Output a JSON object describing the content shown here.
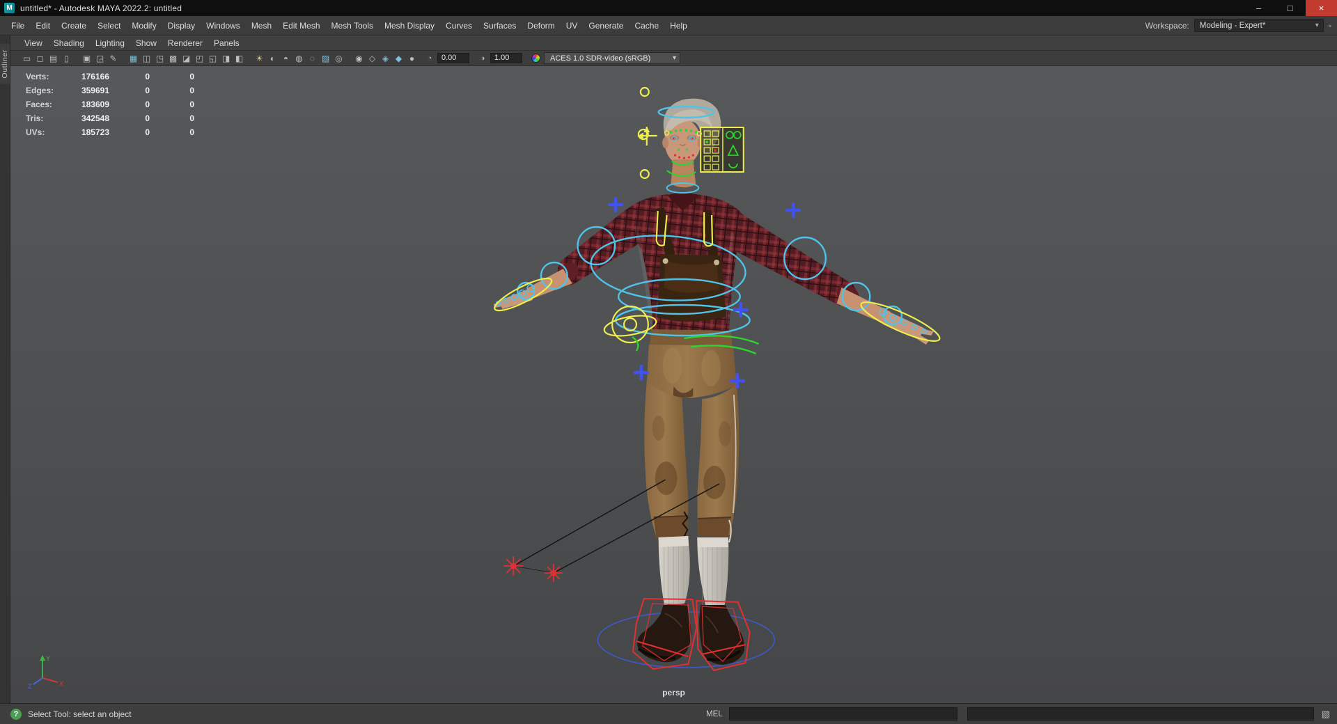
{
  "colors": {
    "rig-cyan": "#4fc3e8",
    "rig-yellow": "#eded4e",
    "rig-green": "#2ed32e",
    "rig-red": "#e23030",
    "rig-blue": "#4053f2",
    "ground-blue": "#3d5bc0"
  },
  "title_bar": {
    "app_icon": "M",
    "title": "untitled* - Autodesk MAYA 2022.2: untitled",
    "minimize_glyph": "–",
    "maximize_glyph": "□",
    "close_glyph": "×"
  },
  "menubar": {
    "items": [
      {
        "name": "menu-item-file",
        "label": "File"
      },
      {
        "name": "menu-item-edit",
        "label": "Edit"
      },
      {
        "name": "menu-item-create",
        "label": "Create"
      },
      {
        "name": "menu-item-select",
        "label": "Select"
      },
      {
        "name": "menu-item-modify",
        "label": "Modify"
      },
      {
        "name": "menu-item-display",
        "label": "Display"
      },
      {
        "name": "menu-item-windows",
        "label": "Windows"
      },
      {
        "name": "menu-item-mesh",
        "label": "Mesh"
      },
      {
        "name": "menu-item-edit-mesh",
        "label": "Edit Mesh"
      },
      {
        "name": "menu-item-mesh-tools",
        "label": "Mesh Tools"
      },
      {
        "name": "menu-item-mesh-display",
        "label": "Mesh Display"
      },
      {
        "name": "menu-item-curves",
        "label": "Curves"
      },
      {
        "name": "menu-item-surfaces",
        "label": "Surfaces"
      },
      {
        "name": "menu-item-deform",
        "label": "Deform"
      },
      {
        "name": "menu-item-uv",
        "label": "UV"
      },
      {
        "name": "menu-item-generate",
        "label": "Generate"
      },
      {
        "name": "menu-item-cache",
        "label": "Cache"
      },
      {
        "name": "menu-item-help",
        "label": "Help"
      }
    ],
    "workspace_label": "Workspace:",
    "workspace_value": "Modeling - Expert*",
    "workspace_caret": "▾",
    "workspace_icon": "▫"
  },
  "panel_menubar": {
    "items": [
      {
        "name": "panel-menu-view",
        "label": "View"
      },
      {
        "name": "panel-menu-shading",
        "label": "Shading"
      },
      {
        "name": "panel-menu-lighting",
        "label": "Lighting"
      },
      {
        "name": "panel-menu-show",
        "label": "Show"
      },
      {
        "name": "panel-menu-renderer",
        "label": "Renderer"
      },
      {
        "name": "panel-menu-panels",
        "label": "Panels"
      }
    ]
  },
  "left_panel": {
    "tab_label": "Outliner"
  },
  "viewport_toolbar": {
    "icons": [
      {
        "name": "select-camera-icon",
        "glyph": "▭"
      },
      {
        "name": "lock-camera-icon",
        "glyph": "◻"
      },
      {
        "name": "camera-attributes-icon",
        "glyph": "▤"
      },
      {
        "name": "bookmarks-icon",
        "glyph": "▯"
      },
      {
        "name": "image-plane-icon",
        "glyph": "▣"
      },
      {
        "name": "pan-zoom-icon",
        "glyph": "◲"
      },
      {
        "name": "grease-pencil-icon",
        "glyph": "✎"
      },
      {
        "name": "grid-icon",
        "glyph": "▦"
      },
      {
        "name": "film-gate-icon",
        "glyph": "◫"
      },
      {
        "name": "resolution-gate-icon",
        "glyph": "◳"
      },
      {
        "name": "gate-mask-icon",
        "glyph": "▩"
      },
      {
        "name": "field-chart-icon",
        "glyph": "◪"
      },
      {
        "name": "safe-action-icon",
        "glyph": "◰"
      },
      {
        "name": "safe-title-icon",
        "glyph": "◱"
      },
      {
        "name": "hud-toggle-icon",
        "glyph": "◨"
      },
      {
        "name": "object-details-icon",
        "glyph": "◧"
      },
      {
        "name": "default-lighting-icon",
        "glyph": "☀"
      },
      {
        "name": "all-lights-icon",
        "glyph": "◐"
      },
      {
        "name": "shadows-icon",
        "glyph": "◓"
      },
      {
        "name": "ambient-occlusion-icon",
        "glyph": "◍"
      },
      {
        "name": "motion-blur-icon",
        "glyph": "◌"
      },
      {
        "name": "multisample-icon",
        "glyph": "▨"
      },
      {
        "name": "depth-of-field-icon",
        "glyph": "◎"
      },
      {
        "name": "isolate-select-icon",
        "glyph": "◉"
      },
      {
        "name": "xray-icon",
        "glyph": "◇"
      },
      {
        "name": "wireframe-on-shaded-icon",
        "glyph": "◈"
      },
      {
        "name": "textured-icon",
        "glyph": "◆"
      },
      {
        "name": "use-default-material-icon",
        "glyph": "●"
      }
    ],
    "exposure_icon": "◔",
    "exposure_value": "0.00",
    "gamma_icon": "◑",
    "gamma_value": "1.00",
    "view_transform": "ACES 1.0 SDR-video (sRGB)",
    "select_caret": "▾"
  },
  "hud": {
    "rows": [
      {
        "label": "Verts:",
        "v1": "176166",
        "v2": "0",
        "v3": "0"
      },
      {
        "label": "Edges:",
        "v1": "359691",
        "v2": "0",
        "v3": "0"
      },
      {
        "label": "Faces:",
        "v1": "183609",
        "v2": "0",
        "v3": "0"
      },
      {
        "label": "Tris:",
        "v1": "342548",
        "v2": "0",
        "v3": "0"
      },
      {
        "label": "UVs:",
        "v1": "185723",
        "v2": "0",
        "v3": "0"
      }
    ]
  },
  "viewport": {
    "camera_label": "persp",
    "axis_x": "X",
    "axis_y": "Y",
    "axis_z": "Z"
  },
  "status_bar": {
    "help_glyph": "?",
    "help_text": "Select Tool: select an object",
    "mel_label": "MEL",
    "command_input": "",
    "command_result": "",
    "script_editor_glyph": "▧"
  }
}
